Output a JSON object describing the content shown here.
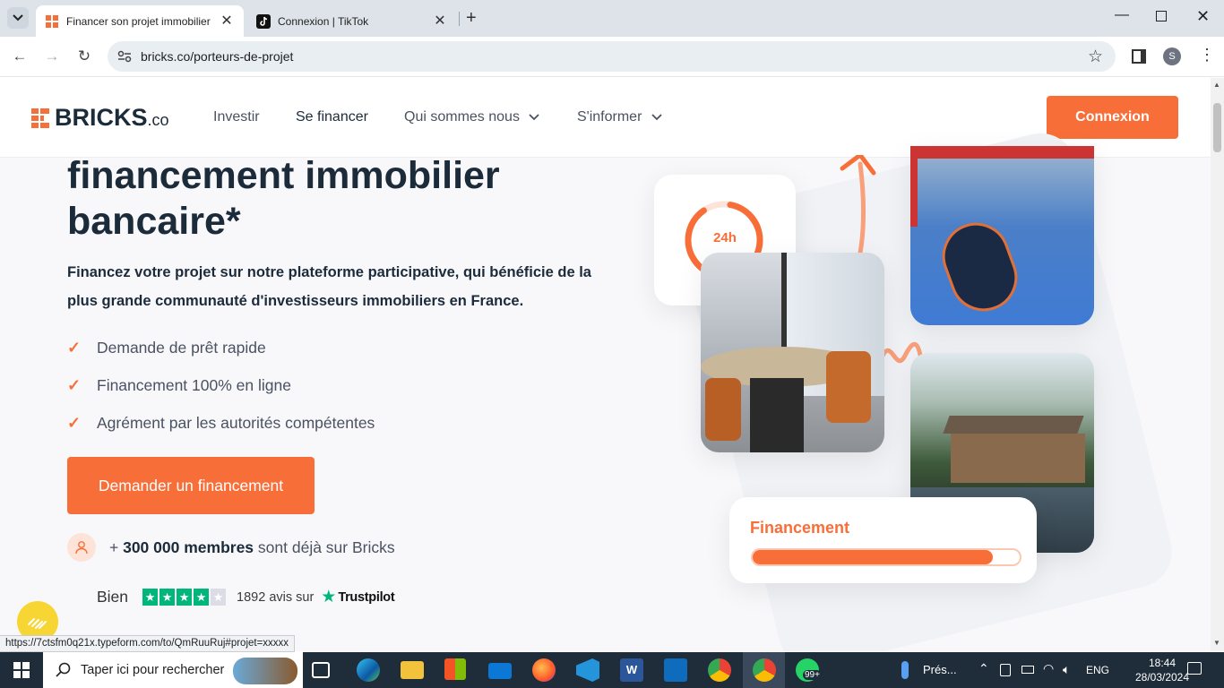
{
  "browser": {
    "tabs": [
      {
        "title": "Financer son projet immobilier",
        "favicon": "bricks-logo-icon",
        "active": true
      },
      {
        "title": "Connexion | TikTok",
        "favicon": "tiktok-icon",
        "active": false
      }
    ],
    "url": "bricks.co/porteurs-de-projet",
    "profile_initial": "S",
    "status_url": "https://7ctsfm0q21x.typeform.com/to/QmRuuRuj#projet=xxxxx"
  },
  "site": {
    "logo_text": "BRICKS",
    "logo_suffix": ".co",
    "nav": {
      "investir": "Investir",
      "se_financer": "Se financer",
      "qui_sommes_nous": "Qui sommes nous",
      "s_informer": "S'informer"
    },
    "login_button": "Connexion"
  },
  "hero": {
    "headline_line1": "financement immobilier",
    "headline_line2": "bancaire*",
    "subtitle": "Financez votre projet sur notre plateforme participative, qui bénéficie de la plus grande communauté d'investisseurs immobiliers en France.",
    "features": [
      "Demande de prêt rapide",
      "Financement 100% en ligne",
      "Agrément par les autorités compétentes"
    ],
    "cta": "Demander un financement",
    "members_prefix": "+ ",
    "members_count": "300 000 membres",
    "members_suffix": " sont déjà sur Bricks",
    "trust_label": "Bien",
    "trust_stars": 4,
    "trust_reviews": "1892 avis sur",
    "trust_brand": "Trustpilot"
  },
  "collage": {
    "timer_label": "24h",
    "financement_label": "Financement",
    "progress_fraction": 0.9
  },
  "taskbar": {
    "search_placeholder": "Taper ici pour rechercher",
    "weather": "Prés...",
    "language": "ENG",
    "time": "18:44",
    "date": "28/03/2024",
    "whatsapp_badge": "99+"
  },
  "colors": {
    "brand_orange": "#f86e38",
    "navy": "#1c2b3a"
  }
}
